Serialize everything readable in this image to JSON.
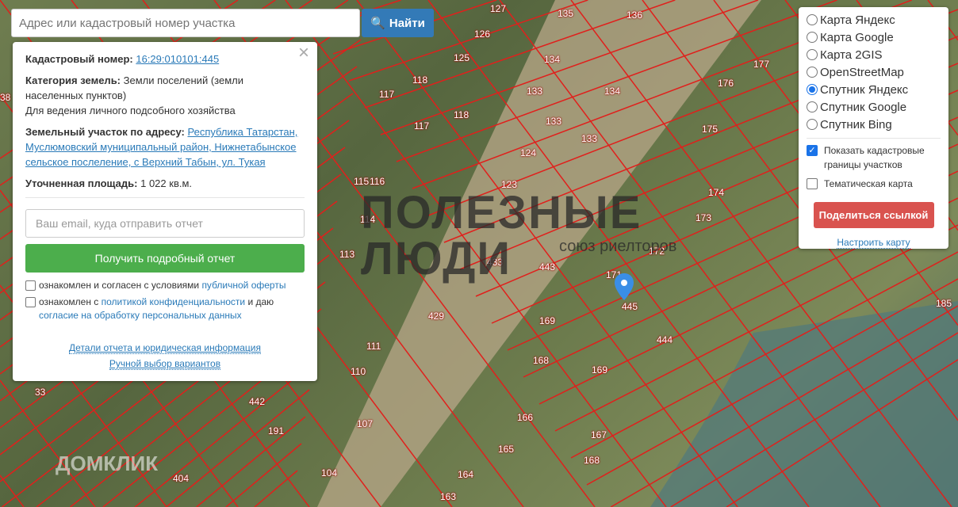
{
  "search": {
    "placeholder": "Адрес или кадастровый номер участка",
    "button": "Найти"
  },
  "info": {
    "cad_label": "Кадастровый номер:",
    "cad_value": "16:29:010101:445",
    "cat_label": "Категория земель:",
    "cat_value": "Земли поселений (земли населенных пунктов)",
    "use": "Для ведения личного подсобного хозяйства",
    "addr_label": "Земельный участок по адресу:",
    "addr_value": "Республика Татарстан, Муслюмовский муниципальный район, Нижнетабынское сельское послеление, с Верхний Табын, ул. Тукая",
    "area_label": "Уточненная площадь:",
    "area_value": "1 022 кв.м.",
    "email_placeholder": "Ваш email, куда отправить отчет",
    "report_button": "Получить подробный отчет",
    "agree1_pre": "ознакомлен и согласен с условиями ",
    "agree1_link": "публичной оферты",
    "agree2_pre": "ознакомлен с ",
    "agree2_link": "политикой конфиденциальности",
    "agree2_mid": " и даю ",
    "agree2_link2": "согласие на обработку персональных данных",
    "details_link": "Детали отчета и юридическая информация",
    "manual_link": "Ручной выбор вариантов"
  },
  "layers": {
    "options": [
      "Карта Яндекс",
      "Карта Google",
      "Карта 2GIS",
      "OpenStreetMap",
      "Спутник Яндекс",
      "Спутник Google",
      "Спутник Bing"
    ],
    "selected": 4,
    "show_borders": "Показать кадастровые границы участков",
    "thematic": "Тематическая карта",
    "share": "Поделиться ссылкой",
    "configure": "Настроить карту"
  },
  "watermark": {
    "line1": "ПОЛЕЗНЫЕ",
    "line2": "ЛЮДИ",
    "sub": "союз риелторов",
    "domclick": "ДОМКЛИК"
  },
  "parcels": [
    "127",
    "135",
    "136",
    "126",
    "125",
    "134",
    "177",
    "118",
    "176",
    "117",
    "133",
    "134",
    "117",
    "118",
    "133",
    "175",
    "124",
    "133",
    "115",
    "116",
    "123",
    "174",
    "114",
    "173",
    "113",
    "172",
    "433",
    "443",
    "171",
    "445",
    "169",
    "429",
    "111",
    "444",
    "110",
    "168",
    "169",
    "185",
    "442",
    "107",
    "166",
    "167",
    "191",
    "165",
    "168",
    "104",
    "404",
    "164",
    "163",
    "33",
    "38"
  ]
}
